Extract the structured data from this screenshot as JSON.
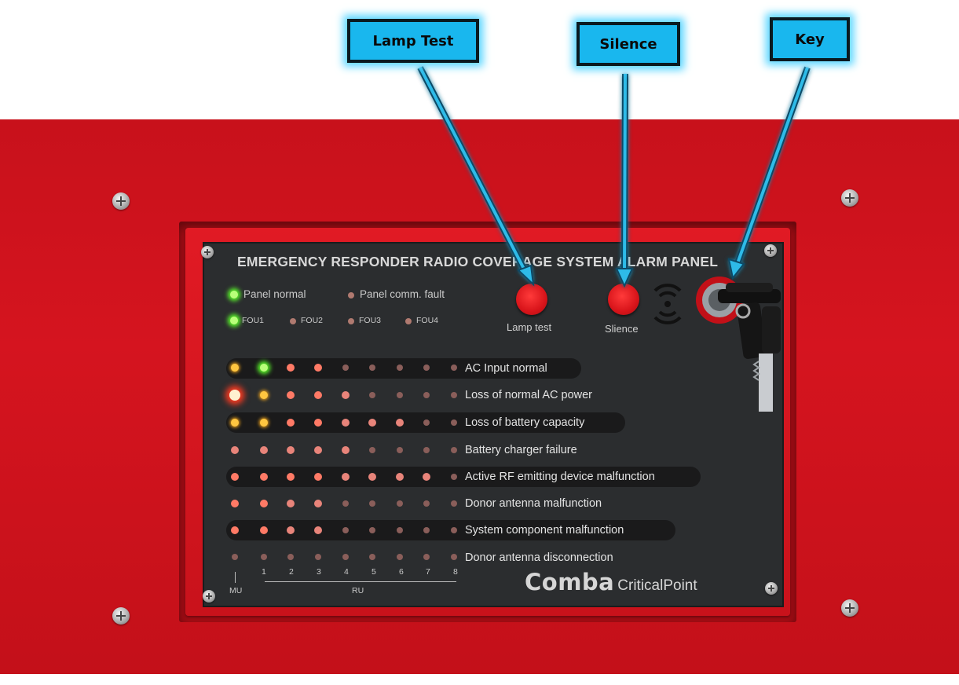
{
  "callouts": {
    "lamp_test": "Lamp Test",
    "silence": "Silence",
    "key": "Key"
  },
  "panel": {
    "title": "EMERGENCY RESPONDER RADIO COVERAGE SYSTEM ALARM PANEL",
    "status": {
      "panel_normal": "Panel normal",
      "panel_comm_fault": "Panel comm. fault"
    },
    "fou": [
      "FOU1",
      "FOU2",
      "FOU3",
      "FOU4"
    ],
    "buttons": {
      "lamp_test": "Lamp test",
      "silence": "Slience"
    },
    "rows": [
      "AC Input normal",
      "Loss of normal AC power",
      "Loss of battery capacity",
      "Battery charger failure",
      "Active RF emitting device malfunction",
      "Donor antenna malfunction",
      "System component malfunction",
      "Donor antenna disconnection"
    ],
    "columns": [
      "1",
      "2",
      "3",
      "4",
      "5",
      "6",
      "7",
      "8"
    ],
    "mu_label": "MU",
    "ru_label": "RU",
    "brand": {
      "logo": "Comba",
      "product": "CriticalPoint"
    }
  },
  "colors": {
    "enclosure": "#c8111b",
    "panel": "#2b2d2f",
    "callout": "#19b7ee",
    "callout_glow": "#5ad6ff"
  }
}
